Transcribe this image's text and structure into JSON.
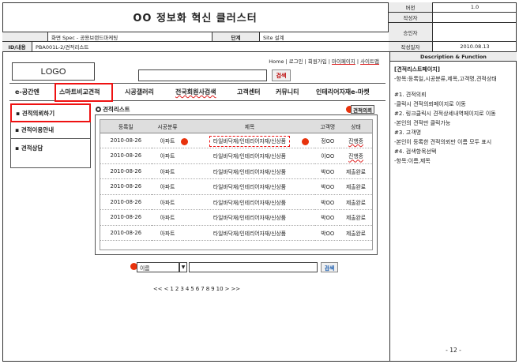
{
  "doc": {
    "title": "OO 정보화 혁신 클러스터",
    "meta": [
      {
        "label": "버전",
        "value": "1.0"
      },
      {
        "label": "작성자",
        "value": ""
      },
      {
        "label": "승인자",
        "value": ""
      },
      {
        "label": "작성일자",
        "value": "2010.08.13"
      }
    ],
    "spec_label": "화면 Spec - 공용브랜드마케팅",
    "stage_label": "단계",
    "stage_value": "Site 설계",
    "id_label": "ID/내용",
    "id_value": "PBA001L-2/견적리스트"
  },
  "right_panel": {
    "head": "Description & Function",
    "lines": [
      {
        "text": "[견적리스트페이지]",
        "bold": true
      },
      {
        "text": "-항목:등록일,시공분류,제목,고객명,견적상태",
        "bold": false
      },
      {
        "text": "",
        "bold": false
      },
      {
        "text": "#1. 견적의뢰",
        "bold": false
      },
      {
        "text": "-클릭시 견적의뢰페이지로 이동",
        "bold": false
      },
      {
        "text": "#2. 링크클릭시 견적상세내역페이지로 이동",
        "bold": false
      },
      {
        "text": "-본인의 견적만 클릭가능",
        "bold": false
      },
      {
        "text": "#3. 고객명",
        "bold": false
      },
      {
        "text": "-본인이 등록한 견적의뢰만 이름 모두 표시",
        "bold": false
      },
      {
        "text": "#4. 검색항목선택",
        "bold": false
      },
      {
        "text": "-항목:이름,제목",
        "bold": false
      }
    ],
    "page": "- 12 -"
  },
  "site": {
    "logo": "LOGO",
    "toplinks": [
      "Home",
      "로그인",
      "회원가입",
      "마이페이지",
      "사이트맵"
    ],
    "search_button": "검색",
    "gnb": [
      "e-공간엔",
      "스마트비교견적",
      "시공갤러리",
      "전국회원사검색",
      "고객센터",
      "커뮤니티",
      "인테리어자재e-마켓"
    ],
    "lnb": [
      "견적의뢰하기",
      "견적이용안내",
      "견적상담"
    ],
    "section_title": "견적리스트",
    "quote_button": "견적의뢰",
    "table": {
      "headers": [
        "등록일",
        "시공분류",
        "제목",
        "고객명",
        "상태"
      ],
      "rows": [
        [
          "2010-08-26",
          "아파트",
          "타일바닥재/인테리어자재/신상품",
          "정OO",
          "진행중"
        ],
        [
          "2010-08-26",
          "아파트",
          "타일바닥재/인테리어자재/신상품",
          "이OO",
          "진행중"
        ],
        [
          "2010-08-26",
          "아파트",
          "타일바닥재/인테리어자재/신상품",
          "박OO",
          "제출완료"
        ],
        [
          "2010-08-26",
          "아파트",
          "타일바닥재/인테리어자재/신상품",
          "박OO",
          "제출완료"
        ],
        [
          "2010-08-26",
          "아파트",
          "타일바닥재/인테리어자재/신상품",
          "박OO",
          "제출완료"
        ],
        [
          "2010-08-26",
          "아파트",
          "타일바닥재/인테리어자재/신상품",
          "박OO",
          "제출완료"
        ],
        [
          "2010-08-26",
          "아파트",
          "타일바닥재/인테리어자재/신상품",
          "박OO",
          "제출완료"
        ]
      ]
    },
    "search_select": "이름",
    "search_go": "검색",
    "pager": [
      "<<",
      "<",
      "1",
      "2",
      "3",
      "4",
      "5",
      "6",
      "7",
      "8",
      "9",
      "10",
      ">",
      ">>"
    ],
    "accent": "#e11111"
  }
}
